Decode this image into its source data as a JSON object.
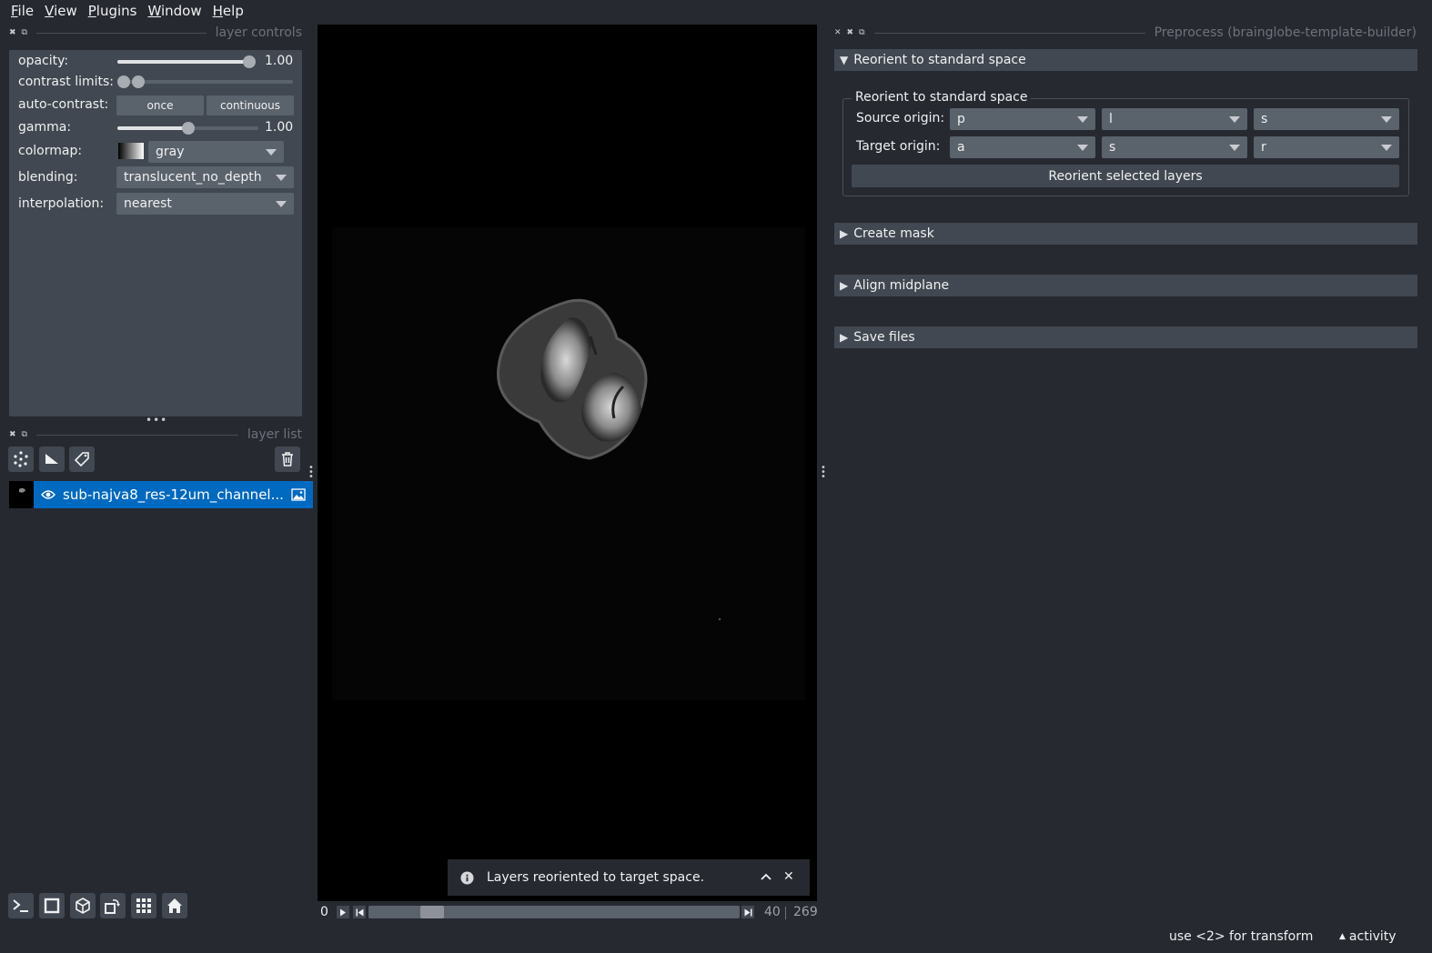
{
  "menu": [
    "File",
    "View",
    "Plugins",
    "Window",
    "Help"
  ],
  "layer_controls": {
    "title": "layer controls",
    "opacity_label": "opacity:",
    "opacity_value": "1.00",
    "opacity_level": 1.0,
    "contrast_label": "contrast limits:",
    "contrast_limits": [
      0.0,
      0.04
    ],
    "auto_contrast_label": "auto-contrast:",
    "once_label": "once",
    "continuous_label": "continuous",
    "gamma_label": "gamma:",
    "gamma_value": "1.00",
    "gamma_level": 0.5,
    "colormap_label": "colormap:",
    "colormap_value": "gray",
    "blending_label": "blending:",
    "blending_value": "translucent_no_depth",
    "interpolation_label": "interpolation:",
    "interpolation_value": "nearest"
  },
  "layer_list": {
    "title": "layer list",
    "layers": [
      {
        "name": "sub-najva8_res-12um_channel...",
        "visible": true,
        "selected": true
      }
    ]
  },
  "notification": {
    "message": "Layers reoriented to target space."
  },
  "dims": {
    "start": "0",
    "current": "40",
    "total": "269",
    "position_fraction": 0.15
  },
  "right_panel": {
    "title": "Preprocess (brainglobe-template-builder)",
    "sections": {
      "reorient_header": "Reorient to standard space",
      "groupbox_title": "Reorient to standard space",
      "source_label": "Source origin:",
      "source": [
        "p",
        "l",
        "s"
      ],
      "target_label": "Target origin:",
      "target": [
        "a",
        "s",
        "r"
      ],
      "reorient_button": "Reorient selected layers",
      "create_mask": "Create mask",
      "align_midplane": "Align midplane",
      "save_files": "Save files"
    }
  },
  "status": {
    "hint": "use <2> for transform",
    "activity": "activity"
  },
  "colors": {
    "background": "#262930",
    "panel": "#414851",
    "control": "#5a626c",
    "selection": "#0069c0",
    "canvas": "#000000"
  }
}
